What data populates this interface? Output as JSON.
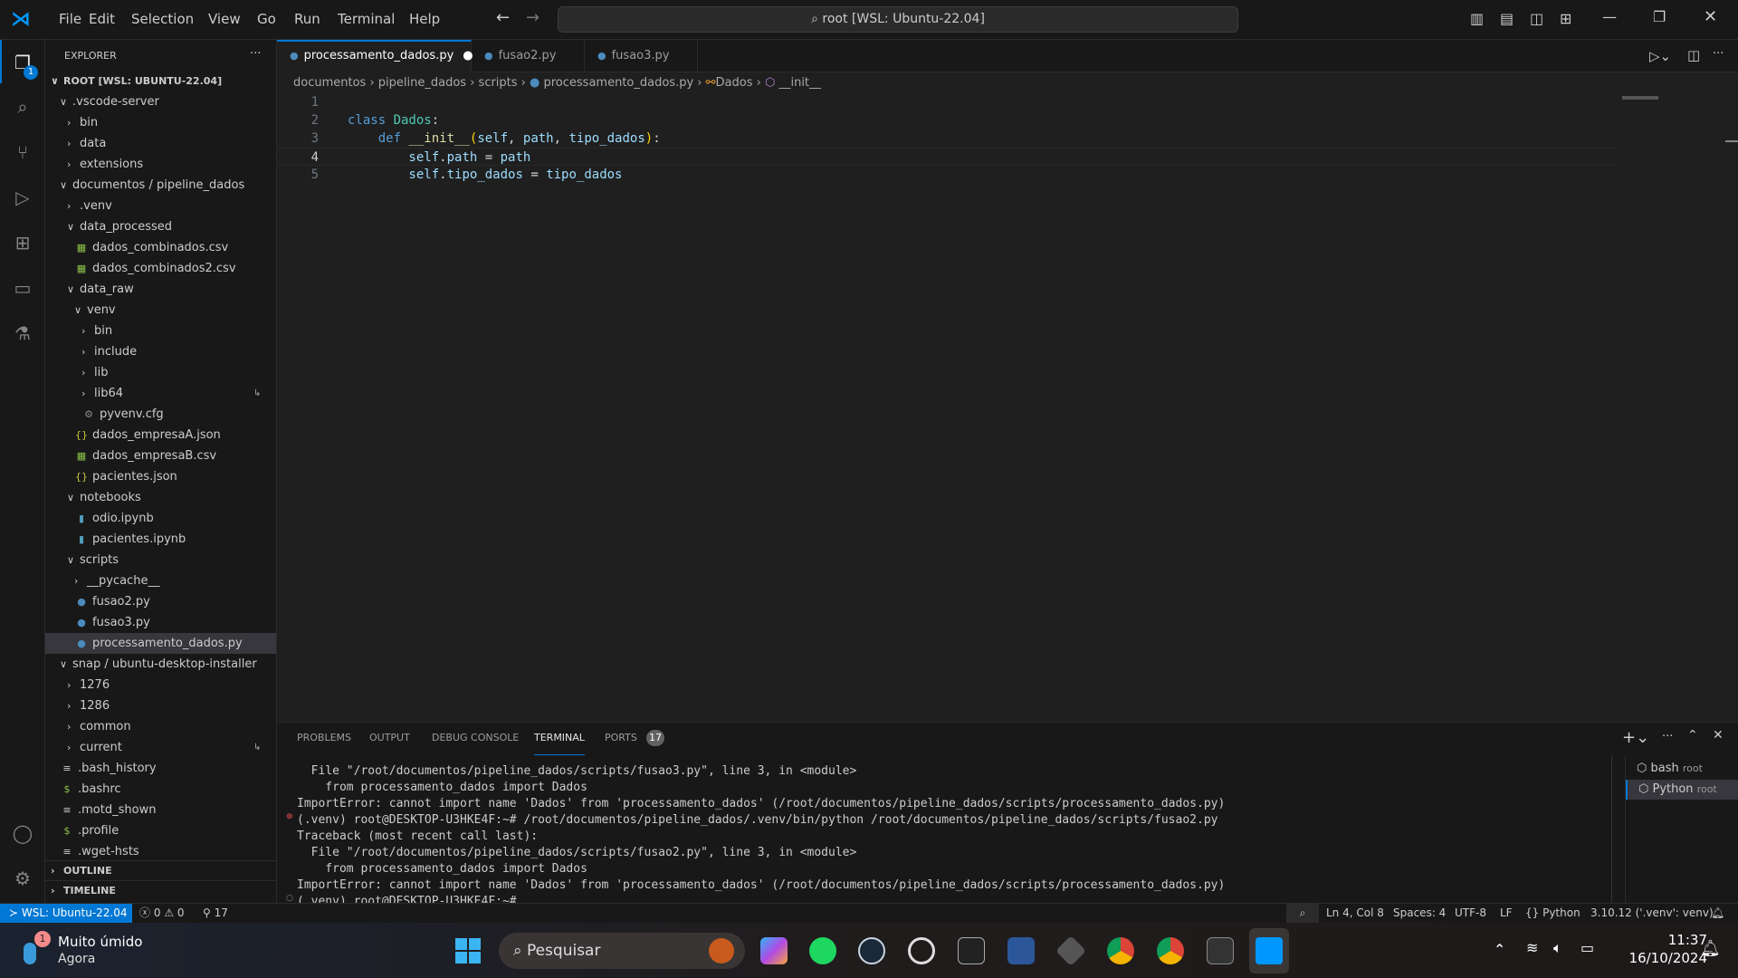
{
  "titlebar": {
    "menu": [
      "File",
      "Edit",
      "Selection",
      "View",
      "Go",
      "Run",
      "Terminal",
      "Help"
    ],
    "search": "root [WSL: Ubuntu-22.04]"
  },
  "activity": {
    "explorer_badge": "1"
  },
  "sidebar": {
    "title": "EXPLORER",
    "root": "ROOT [WSL: UBUNTU-22.04]",
    "items": [
      {
        "label": ".vscode-server",
        "depth": 1,
        "type": "open"
      },
      {
        "label": "bin",
        "depth": 2,
        "type": "closed"
      },
      {
        "label": "data",
        "depth": 2,
        "type": "closed"
      },
      {
        "label": "extensions",
        "depth": 2,
        "type": "closed"
      },
      {
        "label": "documentos / pipeline_dados",
        "depth": 1,
        "type": "open"
      },
      {
        "label": ".venv",
        "depth": 2,
        "type": "closed"
      },
      {
        "label": "data_processed",
        "depth": 2,
        "type": "open"
      },
      {
        "label": "dados_combinados.csv",
        "depth": 3,
        "type": "csv"
      },
      {
        "label": "dados_combinados2.csv",
        "depth": 3,
        "type": "csv"
      },
      {
        "label": "data_raw",
        "depth": 2,
        "type": "open"
      },
      {
        "label": "venv",
        "depth": 3,
        "type": "open"
      },
      {
        "label": "bin",
        "depth": 4,
        "type": "closed"
      },
      {
        "label": "include",
        "depth": 4,
        "type": "closed"
      },
      {
        "label": "lib",
        "depth": 4,
        "type": "closed"
      },
      {
        "label": "lib64",
        "depth": 4,
        "type": "closed",
        "link": true
      },
      {
        "label": "pyvenv.cfg",
        "depth": 4,
        "type": "cfg"
      },
      {
        "label": "dados_empresaA.json",
        "depth": 3,
        "type": "json"
      },
      {
        "label": "dados_empresaB.csv",
        "depth": 3,
        "type": "csv"
      },
      {
        "label": "pacientes.json",
        "depth": 3,
        "type": "json"
      },
      {
        "label": "notebooks",
        "depth": 2,
        "type": "open"
      },
      {
        "label": "odio.ipynb",
        "depth": 3,
        "type": "nb"
      },
      {
        "label": "pacientes.ipynb",
        "depth": 3,
        "type": "nb"
      },
      {
        "label": "scripts",
        "depth": 2,
        "type": "open"
      },
      {
        "label": "__pycache__",
        "depth": 3,
        "type": "closed"
      },
      {
        "label": "fusao2.py",
        "depth": 3,
        "type": "py"
      },
      {
        "label": "fusao3.py",
        "depth": 3,
        "type": "py"
      },
      {
        "label": "processamento_dados.py",
        "depth": 3,
        "type": "py",
        "selected": true
      },
      {
        "label": "snap / ubuntu-desktop-installer",
        "depth": 1,
        "type": "open"
      },
      {
        "label": "1276",
        "depth": 2,
        "type": "closed"
      },
      {
        "label": "1286",
        "depth": 2,
        "type": "closed"
      },
      {
        "label": "common",
        "depth": 2,
        "type": "closed"
      },
      {
        "label": "current",
        "depth": 2,
        "type": "closed",
        "link": true
      },
      {
        "label": ".bash_history",
        "depth": 1,
        "type": "txt"
      },
      {
        "label": ".bashrc",
        "depth": 1,
        "type": "sh"
      },
      {
        "label": ".motd_shown",
        "depth": 1,
        "type": "txt"
      },
      {
        "label": ".profile",
        "depth": 1,
        "type": "sh"
      },
      {
        "label": ".wget-hsts",
        "depth": 1,
        "type": "txt"
      }
    ],
    "outline": "OUTLINE",
    "timeline": "TIMELINE"
  },
  "tabs": [
    {
      "label": "processamento_dados.py",
      "active": true,
      "dirty": true
    },
    {
      "label": "fusao2.py"
    },
    {
      "label": "fusao3.py"
    }
  ],
  "breadcrumb": [
    "documentos",
    "pipeline_dados",
    "scripts",
    "processamento_dados.py",
    "Dados",
    "__init__"
  ],
  "code": [
    {
      "n": "1",
      "tokens": []
    },
    {
      "n": "2",
      "tokens": [
        {
          "t": "class ",
          "k": "k"
        },
        {
          "t": "Dados",
          "k": "cn"
        },
        {
          "t": ":",
          "k": "t"
        }
      ]
    },
    {
      "n": "3",
      "tokens": [
        {
          "t": "    def ",
          "k": "k"
        },
        {
          "t": "__init__",
          "k": "fn"
        },
        {
          "t": "(",
          "k": "y"
        },
        {
          "t": "self",
          "k": "p"
        },
        {
          "t": ", ",
          "k": "t"
        },
        {
          "t": "path",
          "k": "p"
        },
        {
          "t": ", ",
          "k": "t"
        },
        {
          "t": "tipo_dados",
          "k": "p"
        },
        {
          "t": ")",
          "k": "y"
        },
        {
          "t": ":",
          "k": "t"
        }
      ]
    },
    {
      "n": "4",
      "tokens": [
        {
          "t": "        self",
          "k": "p"
        },
        {
          "t": ".",
          "k": "t"
        },
        {
          "t": "path",
          "k": "p"
        },
        {
          "t": " = ",
          "k": "t"
        },
        {
          "t": "path",
          "k": "p"
        }
      ],
      "current": true
    },
    {
      "n": "5",
      "tokens": [
        {
          "t": "        self",
          "k": "p"
        },
        {
          "t": ".",
          "k": "t"
        },
        {
          "t": "tipo_dados",
          "k": "p"
        },
        {
          "t": " = ",
          "k": "t"
        },
        {
          "t": "tipo_dados",
          "k": "p"
        }
      ]
    }
  ],
  "panel": {
    "tabs": [
      "PROBLEMS",
      "OUTPUT",
      "DEBUG CONSOLE",
      "TERMINAL",
      "PORTS"
    ],
    "ports_badge": "17",
    "terminal": [
      "  File \"/root/documentos/pipeline_dados/scripts/fusao3.py\", line 3, in <module>",
      "    from processamento_dados import Dados",
      "ImportError: cannot import name 'Dados' from 'processamento_dados' (/root/documentos/pipeline_dados/scripts/processamento_dados.py)",
      "(.venv) root@DESKTOP-U3HKE4F:~# /root/documentos/pipeline_dados/.venv/bin/python /root/documentos/pipeline_dados/scripts/fusao2.py",
      "Traceback (most recent call last):",
      "  File \"/root/documentos/pipeline_dados/scripts/fusao2.py\", line 3, in <module>",
      "    from processamento_dados import Dados",
      "ImportError: cannot import name 'Dados' from 'processamento_dados' (/root/documentos/pipeline_dados/scripts/processamento_dados.py)",
      "(.venv) root@DESKTOP-U3HKE4F:~# "
    ],
    "sessions": [
      {
        "name": "bash",
        "user": "root"
      },
      {
        "name": "Python",
        "user": "root"
      }
    ]
  },
  "status": {
    "remote": "WSL: Ubuntu-22.04",
    "errors": "0",
    "warnings": "0",
    "ports": "17",
    "position": "Ln 4, Col 8",
    "spaces": "Spaces: 4",
    "encoding": "UTF-8",
    "eol": "LF",
    "language": "Python",
    "interpreter": "3.10.12 ('.venv': venv)"
  },
  "taskbar": {
    "weather_title": "Muito úmido",
    "weather_sub": "Agora",
    "weather_badge": "1",
    "search": "Pesquisar",
    "time": "11:37",
    "date": "16/10/2024"
  },
  "colors": {
    "accent": "#0078d4",
    "remote": "#0078d4",
    "error": "#f14c4c"
  }
}
